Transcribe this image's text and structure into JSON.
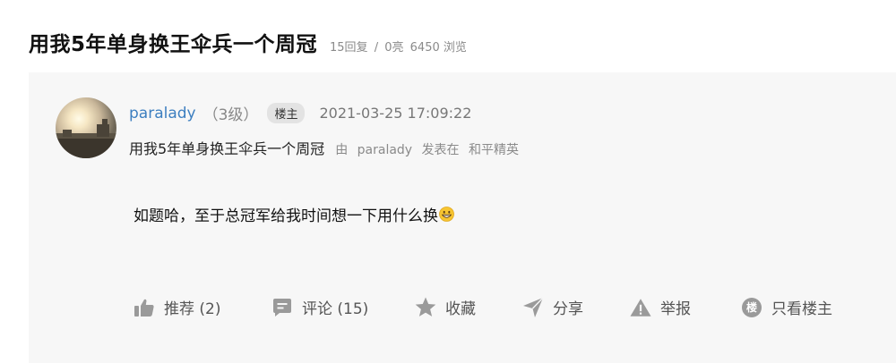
{
  "thread": {
    "title": "用我5年单身换王伞兵一个周冠",
    "replies": "15回复",
    "separator": "/",
    "likes": "0亮",
    "views": "6450 浏览"
  },
  "post": {
    "username": "paralady",
    "level": "（3级）",
    "owner_badge": "楼主",
    "time": "2021-03-25 17:09:22",
    "subtitle": "用我5年单身换王伞兵一个周冠",
    "source_prefix": "由",
    "source_user": "paralady",
    "source_verb": "发表在",
    "source_board": "和平精英",
    "content": "如题哈，至于总冠军给我时间想一下用什么换",
    "emoji": "grinning-face-emoji"
  },
  "actions": {
    "like_label": "推荐 (2)",
    "comment_label": "评论 (15)",
    "favorite_label": "收藏",
    "share_label": "分享",
    "report_label": "举报",
    "owner_only_label": "只看楼主",
    "floor_glyph": "楼"
  },
  "icons": {
    "like": "thumbs-up-icon",
    "comment": "comment-icon",
    "favorite": "star-icon",
    "share": "paper-plane-icon",
    "report": "warning-icon",
    "owner_only": "floor-owner-icon"
  },
  "colors": {
    "username": "#3d7fc0",
    "muted": "#8a8a8a",
    "card_background": "#f7f7f7",
    "icon_gray": "#9a9a9a"
  }
}
